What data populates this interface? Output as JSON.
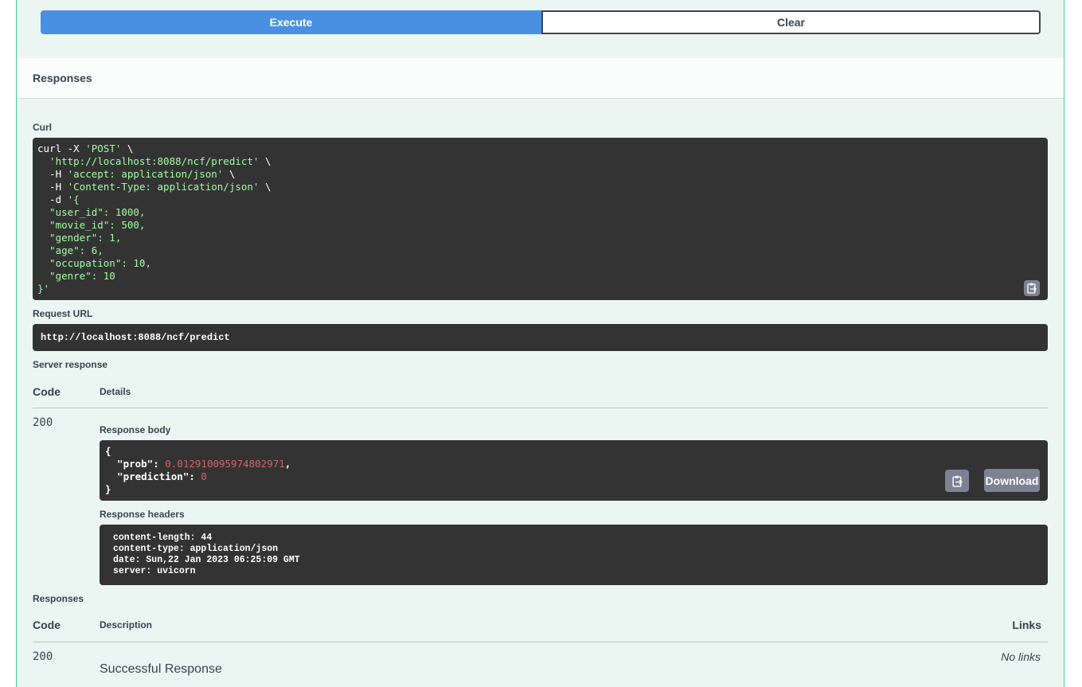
{
  "buttons": {
    "execute": "Execute",
    "clear": "Clear",
    "download": "Download"
  },
  "section_title": "Responses",
  "curl": {
    "label": "Curl",
    "lines": [
      [
        [
          "plain",
          "curl -X "
        ],
        [
          "str",
          "'POST'"
        ],
        [
          "plain",
          " \\"
        ]
      ],
      [
        [
          "str",
          "  'http://localhost:8088/ncf/predict'"
        ],
        [
          "plain",
          " \\"
        ]
      ],
      [
        [
          "plain",
          "  -H "
        ],
        [
          "str",
          "'accept: application/json'"
        ],
        [
          "plain",
          " \\"
        ]
      ],
      [
        [
          "plain",
          "  -H "
        ],
        [
          "str",
          "'Content-Type: application/json'"
        ],
        [
          "plain",
          " \\"
        ]
      ],
      [
        [
          "plain",
          "  -d "
        ],
        [
          "str",
          "'{"
        ]
      ],
      [
        [
          "str",
          "  \"user_id\": 1000,"
        ]
      ],
      [
        [
          "str",
          "  \"movie_id\": 500,"
        ]
      ],
      [
        [
          "str",
          "  \"gender\": 1,"
        ]
      ],
      [
        [
          "str",
          "  \"age\": 6,"
        ]
      ],
      [
        [
          "str",
          "  \"occupation\": 10,"
        ]
      ],
      [
        [
          "str",
          "  \"genre\": 10"
        ]
      ],
      [
        [
          "str",
          "}'"
        ]
      ]
    ]
  },
  "request_url": {
    "label": "Request URL",
    "value": "http://localhost:8088/ncf/predict"
  },
  "server_response": {
    "label": "Server response",
    "col_code": "Code",
    "col_details": "Details",
    "code": "200",
    "body_label": "Response body",
    "body": {
      "open": "{",
      "prob_key": "  \"prob\": ",
      "prob_value": "0.012910095974802971",
      "prob_comma": ",",
      "prediction_key": "  \"prediction\": ",
      "prediction_value": "0",
      "close": "}"
    },
    "headers_label": "Response headers",
    "headers": [
      "content-length: 44",
      "content-type: application/json",
      "date: Sun,22 Jan 2023 06:25:09 GMT",
      "server: uvicorn"
    ]
  },
  "responses": {
    "label": "Responses",
    "col_code": "Code",
    "col_description": "Description",
    "col_links": "Links",
    "code": "200",
    "description": "Successful Response",
    "links": "No links"
  }
}
